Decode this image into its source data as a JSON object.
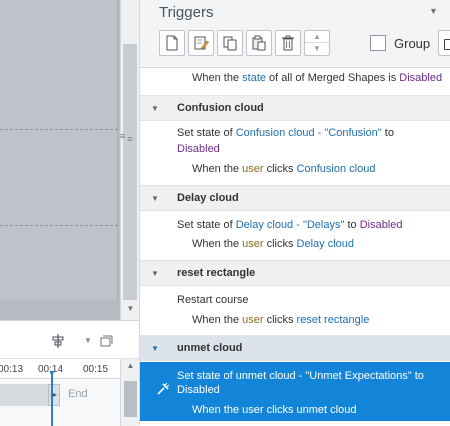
{
  "panel": {
    "title": "Triggers",
    "group_label": "Group"
  },
  "timeline": {
    "ticks": [
      "00:13",
      "00:14",
      "00:15"
    ],
    "end_label": "End"
  },
  "triggers": {
    "partial_top": {
      "prefix": "When the ",
      "state_word": "state",
      "middle": " of all of Merged Shapes is ",
      "value": "Disabled"
    },
    "groups": [
      {
        "name": "Confusion cloud",
        "action_prefix": "Set state of ",
        "action_target": "Confusion cloud - \"Confusion\"",
        "action_to": " to",
        "action_value": "Disabled",
        "cond_prefix": "When the ",
        "cond_user": "user",
        "cond_clicks": " clicks ",
        "cond_target": "Confusion cloud"
      },
      {
        "name": "Delay cloud",
        "action_prefix": "Set state of ",
        "action_target": "Delay cloud - \"Delays\"",
        "action_to": " to ",
        "action_value": "Disabled",
        "cond_prefix": "When the ",
        "cond_user": "user",
        "cond_clicks": " clicks ",
        "cond_target": "Delay cloud"
      },
      {
        "name": "reset rectangle",
        "action_prefix": "Restart course",
        "cond_prefix": "When the ",
        "cond_user": "user",
        "cond_clicks": " clicks ",
        "cond_target": "reset rectangle"
      },
      {
        "name": "unmet cloud",
        "action_line1": "Set state of unmet cloud - \"Unmet Expectations\" to",
        "action_line2": "Disabled",
        "cond": "When the user clicks unmet cloud"
      }
    ]
  },
  "colors": {
    "selection": "#1385d9",
    "link": "#1f6fb0",
    "state_value": "#6b2d87",
    "user_word": "#8a6d1a"
  }
}
